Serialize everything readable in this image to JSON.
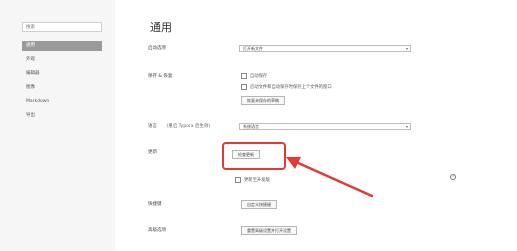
{
  "sidebar": {
    "search_placeholder": "搜索",
    "items": [
      {
        "label": "通用",
        "active": true
      },
      {
        "label": "外观"
      },
      {
        "label": "编辑器"
      },
      {
        "label": "图像"
      },
      {
        "label": "Markdown"
      },
      {
        "label": "导出"
      }
    ]
  },
  "main": {
    "title": "通用",
    "startup": {
      "label": "启动选项",
      "value": "打开新文件"
    },
    "save": {
      "label": "保存 & 恢复",
      "autosave": "自动保存",
      "restore_window": "启动文件和自动保存时保存上个文件的窗口",
      "recover_button": "恢复未保存的草稿"
    },
    "language": {
      "label": "语言",
      "note": "(重启 Typora 后生效)",
      "value": "系统语言"
    },
    "update": {
      "label": "更新",
      "check_button": "检查更新",
      "beta_label": "更新至开发版"
    },
    "shortcuts": {
      "label": "快捷键",
      "button": "自定义快捷键"
    },
    "advanced": {
      "label": "高级选项",
      "button": "重置高级设置并打开设置"
    }
  },
  "colors": {
    "annotation": "#e53935",
    "sidebar_active": "#9a9a9a"
  }
}
